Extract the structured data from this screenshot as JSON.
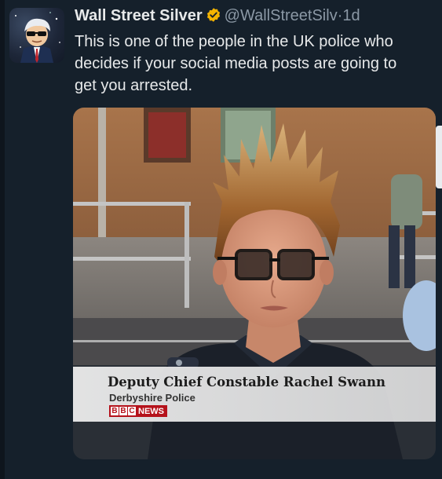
{
  "tweet": {
    "author_name": "Wall Street Silver",
    "handle": "@WallStreetSilv",
    "separator": "·",
    "time": "1d",
    "text_lines": [
      "This is one of the people in the UK police who",
      "decides if your social media posts are going to",
      "get you arrested."
    ]
  },
  "media": {
    "caption_title": "Deputy Chief Constable Rachel Swann",
    "caption_subtitle": "Derbyshire Police",
    "broadcaster_letters": [
      "B",
      "B",
      "C"
    ],
    "broadcaster_label": "NEWS"
  },
  "colors": {
    "background": "#15202b",
    "text": "#e7e9ea",
    "muted": "#8b98a5",
    "verified": "#f4b400",
    "bbc_red": "#b5121b"
  },
  "icons": {
    "verified": "verified-badge-icon"
  }
}
